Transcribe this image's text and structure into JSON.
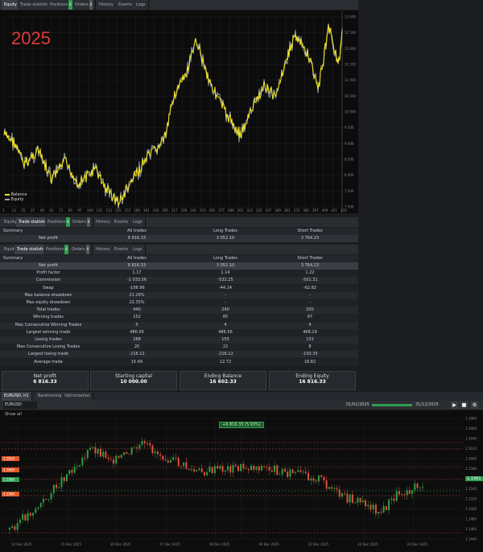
{
  "top_tabs": [
    {
      "label": "Equity"
    },
    {
      "label": "Trade statistics"
    },
    {
      "label": "Positions",
      "badge": "6"
    },
    {
      "label": "Orders",
      "badge": "0"
    },
    {
      "label": "History"
    },
    {
      "label": "Events"
    },
    {
      "label": "Logs"
    }
  ],
  "equity_chart": {
    "year_label": "2025",
    "legend": [
      "Balance",
      "Equity"
    ],
    "y_ticks": [
      "13 000",
      "12 500",
      "12 000",
      "11 500",
      "11 000",
      "10 500",
      "10 000",
      "9 500",
      "9 000",
      "8 500",
      "8 000",
      "7 500",
      "7 000"
    ],
    "x_ticks": [
      "1",
      "13",
      "25",
      "37",
      "49",
      "61",
      "73",
      "85",
      "97",
      "109",
      "121",
      "133",
      "145",
      "157",
      "169",
      "181",
      "193",
      "205",
      "217",
      "229",
      "241",
      "253",
      "265",
      "277",
      "289",
      "301",
      "313",
      "325",
      "337",
      "349",
      "361",
      "373",
      "385",
      "397",
      "409",
      "421",
      "433"
    ]
  },
  "mid_tabs": [
    {
      "label": "Equity"
    },
    {
      "label": "Trade statistics"
    },
    {
      "label": "Positions",
      "badge": "6"
    },
    {
      "label": "Orders",
      "badge": "0"
    },
    {
      "label": "History"
    },
    {
      "label": "Events"
    },
    {
      "label": "Logs"
    }
  ],
  "summary": {
    "headers": [
      "Summary",
      "All trades",
      "Long Trades",
      "Short Trades"
    ],
    "row": [
      "Net profit",
      "6 816.33",
      "3 052.10",
      "3 764.23"
    ]
  },
  "lower_tabs": [
    {
      "label": "Equity"
    },
    {
      "label": "Trade statistics"
    },
    {
      "label": "Positions",
      "badge": "6"
    },
    {
      "label": "Orders",
      "badge": "0"
    },
    {
      "label": "History"
    },
    {
      "label": "Events"
    },
    {
      "label": "Logs"
    }
  ],
  "stats": {
    "headers": [
      "Summary",
      "All trades",
      "Long Trades",
      "Short Trades"
    ],
    "rows": [
      [
        "Net profit",
        "6 816.33",
        "3 052.10",
        "3 764.23"
      ],
      [
        "Profit factor",
        "1.17",
        "1.14",
        "1.22"
      ],
      [
        "Commission",
        "-1 033.56",
        "-532.25",
        "-501.31"
      ],
      [
        "Swap",
        "-106.96",
        "-44.14",
        "-62.82"
      ],
      [
        "Max balance drawdown",
        "21.26%",
        "-",
        "-"
      ],
      [
        "Max equity drawdown",
        "22.35%",
        "-",
        "-"
      ],
      [
        "Total trades",
        "440",
        "240",
        "200"
      ],
      [
        "Winning trades",
        "152",
        "85",
        "67"
      ],
      [
        "Max Consecutive Winning Trades",
        "5",
        "4",
        "4"
      ],
      [
        "Largest winning trade",
        "486.56",
        "486.56",
        "468.29"
      ],
      [
        "Losing trades",
        "288",
        "155",
        "133"
      ],
      [
        "Max Consecutive Losing Trades",
        "20",
        "22",
        "8"
      ],
      [
        "Largest losing trade",
        "-216.12",
        "-216.12",
        "-193.35"
      ],
      [
        "Average trade",
        "15.49",
        "12.72",
        "18.82"
      ]
    ]
  },
  "cards": [
    {
      "title": "Net profit",
      "value": "6 816.33"
    },
    {
      "title": "Starting capital",
      "value": "10 000.00"
    },
    {
      "title": "Ending Balance",
      "value": "16 602.33"
    },
    {
      "title": "Ending Equity",
      "value": "16 816.33"
    }
  ],
  "bottom_tabs": [
    {
      "label": "EURUSD, h1"
    },
    {
      "label": "Backtesting"
    },
    {
      "label": "Optimization"
    }
  ],
  "bottom_toolbar": {
    "symbol": "EURUSD",
    "date_from": "01/01/2025",
    "date_to": "31/12/2025"
  },
  "price_chart": {
    "pnl_label": "+6 816.33 (5.93%)",
    "show_label": "Show all",
    "price_ticks": [
      "1.1680",
      "1.1660",
      "1.1640",
      "1.1620",
      "1.1600",
      "1.1580",
      "1.1560",
      "1.1540",
      "1.1520",
      "1.1500",
      "1.1480",
      "1.1460",
      "1.1440"
    ],
    "current_price": "1.1561",
    "time_ticks": [
      "14 Dec 2025",
      "15 Dec 2025",
      "16 Dec 2025",
      "17 Dec 2025",
      "18 Dec 2025",
      "19 Dec 2025",
      "22 Dec 2025",
      "23 Dec 2025",
      "24 Dec 2025"
    ],
    "left_markers": [
      "1.1620",
      "1.1600",
      "1.1580",
      "1.1560"
    ]
  },
  "colors": {
    "balance": "#f2e61c",
    "equity": "#9ba0a5",
    "bull": "#2f9e44",
    "bear": "#e0513a",
    "accent": "#e05a2a"
  }
}
